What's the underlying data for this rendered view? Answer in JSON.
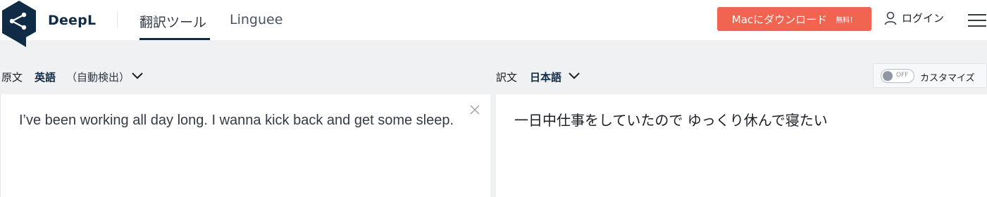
{
  "header": {
    "brand": "DeepL",
    "nav": [
      {
        "label": "翻訳ツール",
        "active": true
      },
      {
        "label": "Linguee",
        "active": false
      }
    ],
    "download_button": {
      "label": "Macにダウンロード",
      "badge": "無料！"
    },
    "login_label": "ログイン",
    "icons": {
      "logo": "deepl-logo-icon",
      "user": "user-icon",
      "menu": "hamburger-menu-icon"
    }
  },
  "source": {
    "bar_label": "原文",
    "language": "英語",
    "auto_detect": "（自動検出）",
    "text": "I’ve been working all day long. I wanna kick back and get some sleep."
  },
  "target": {
    "bar_label": "訳文",
    "language": "日本語",
    "text": "一日中仕事をしていたので ゆっくり休んで寝たい"
  },
  "customize": {
    "toggle_state": "OFF",
    "label": "カスタマイズ"
  },
  "colors": {
    "brand_navy": "#0f2b46",
    "download_orange": "#f16450",
    "background": "#f0f1f3"
  }
}
